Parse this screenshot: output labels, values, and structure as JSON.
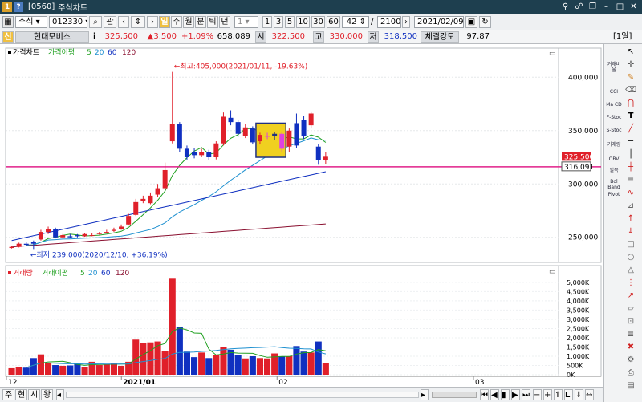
{
  "window": {
    "code": "[0560]",
    "title": "주식차트"
  },
  "toolbar": {
    "market": "주식",
    "symbol": "012330",
    "btn_relation": "관",
    "period_buttons": [
      "주",
      "월",
      "분",
      "틱",
      "년"
    ],
    "period_unit": "1",
    "minute_buttons": [
      "1",
      "3",
      "5",
      "10",
      "30",
      "60"
    ],
    "count": "42",
    "total": "2100",
    "date": "2021/02/09"
  },
  "quote": {
    "name": "현대모비스",
    "info_btn": "i",
    "price": "325,500",
    "change": "▲3,500",
    "pct": "+1.09%",
    "volume": "658,089",
    "open_label": "시",
    "open": "322,500",
    "high_label": "고",
    "high": "330,000",
    "low_label": "저",
    "low": "318,500",
    "strength_label": "체결강도",
    "strength": "97.87",
    "period_badge": "[1일]"
  },
  "price_panel": {
    "legend": {
      "name": "가격차트",
      "ma_label": "가격이평",
      "ma": [
        "5",
        "20",
        "60",
        "120"
      ]
    },
    "max_annot": "←최고:405,000(2021/01/11, -19.63%)",
    "min_annot": "←최저:239,000(2020/12/10, +36.19%)",
    "current_price_tag": "325,500",
    "line_price_tag": "316,091",
    "y_ticks": [
      "400,000",
      "350,000",
      "300,000",
      "250,000"
    ]
  },
  "volume_panel": {
    "legend": {
      "name": "거래량",
      "ma_label": "거래이평",
      "ma": [
        "5",
        "20",
        "60",
        "120"
      ]
    },
    "y_ticks": [
      "5,000K",
      "4,500K",
      "4,000K",
      "3,500K",
      "3,000K",
      "2,500K",
      "2,000K",
      "1,500K",
      "1,000K",
      "500K",
      "0K"
    ]
  },
  "x_axis": {
    "labels": [
      "12",
      "2021/01",
      "02",
      "03"
    ]
  },
  "bottom_tabs": [
    "주",
    "현",
    "시",
    "왕"
  ],
  "right_tools": [
    "거래비율",
    "CCI",
    "Ma CD",
    "F-Stoc",
    "S-Stoc",
    "거래량",
    "OBV",
    "일목",
    "Bol Band",
    "Pivot"
  ],
  "colors": {
    "up": "#e0202a",
    "down": "#1030c0",
    "ma5": "#20a020",
    "ma20": "#1e90d0",
    "ma60": "#1030c0",
    "ma120": "#8a1030",
    "hline": "#e0208a",
    "highlight": "#f0d020",
    "highlight_candle": "#e040e0"
  },
  "chart_data": {
    "type": "candlestick",
    "x": [
      "2020-12-07",
      "2020-12-08",
      "2020-12-09",
      "2020-12-10",
      "2020-12-11",
      "2020-12-14",
      "2020-12-15",
      "2020-12-16",
      "2020-12-17",
      "2020-12-18",
      "2020-12-21",
      "2020-12-22",
      "2020-12-23",
      "2020-12-24",
      "2020-12-28",
      "2020-12-29",
      "2020-12-30",
      "2021-01-04",
      "2021-01-05",
      "2021-01-06",
      "2021-01-07",
      "2021-01-08",
      "2021-01-11",
      "2021-01-12",
      "2021-01-13",
      "2021-01-14",
      "2021-01-15",
      "2021-01-18",
      "2021-01-19",
      "2021-01-20",
      "2021-01-21",
      "2021-01-22",
      "2021-01-25",
      "2021-01-26",
      "2021-01-27",
      "2021-01-28",
      "2021-01-29",
      "2021-02-01",
      "2021-02-02",
      "2021-02-03",
      "2021-02-04",
      "2021-02-05",
      "2021-02-08",
      "2021-02-09"
    ],
    "open": [
      240000,
      241000,
      244000,
      246000,
      248000,
      255000,
      258000,
      250000,
      251000,
      252000,
      251000,
      252000,
      253000,
      254000,
      256000,
      258000,
      262000,
      271000,
      284000,
      282000,
      290000,
      296000,
      340000,
      356000,
      333000,
      330000,
      327000,
      330000,
      325000,
      338000,
      362000,
      358000,
      345000,
      352000,
      340000,
      345000,
      345000,
      347000,
      335000,
      357000,
      360000,
      355000,
      335000,
      322500
    ],
    "close": [
      241000,
      244000,
      243000,
      244000,
      255000,
      258000,
      250000,
      252000,
      250000,
      251000,
      253000,
      252000,
      254000,
      255000,
      257000,
      260000,
      270000,
      283000,
      286000,
      289000,
      296000,
      313000,
      356000,
      333000,
      325000,
      327000,
      330000,
      325000,
      338000,
      363000,
      358000,
      347000,
      353000,
      339000,
      346000,
      345000,
      347000,
      333000,
      350000,
      336000,
      345000,
      366000,
      322000,
      325500
    ],
    "high": [
      242000,
      245000,
      246000,
      247000,
      257000,
      260000,
      259000,
      253000,
      253000,
      253000,
      254000,
      254000,
      255000,
      257000,
      259000,
      262000,
      272000,
      286000,
      289000,
      292000,
      300000,
      320000,
      405000,
      358000,
      336000,
      334000,
      333000,
      332000,
      340000,
      367000,
      369000,
      360000,
      356000,
      354000,
      348000,
      348000,
      349000,
      349000,
      352000,
      366000,
      364000,
      368000,
      337000,
      330000
    ],
    "low": [
      239500,
      240500,
      242000,
      239000,
      247000,
      253000,
      249000,
      249000,
      249500,
      250000,
      250500,
      251000,
      252500,
      253500,
      255000,
      257000,
      261000,
      270000,
      282000,
      281000,
      288000,
      294000,
      338000,
      330000,
      322000,
      324000,
      325000,
      322000,
      323000,
      336000,
      355000,
      344000,
      343000,
      337000,
      337000,
      342000,
      341000,
      330000,
      330000,
      334000,
      342000,
      352000,
      318000,
      318500
    ],
    "volume_k": [
      350,
      420,
      380,
      900,
      1100,
      650,
      520,
      480,
      500,
      600,
      430,
      700,
      520,
      560,
      620,
      480,
      700,
      1900,
      1700,
      1750,
      1800,
      1300,
      5200,
      2600,
      1250,
      950,
      1200,
      900,
      1050,
      1500,
      1350,
      1050,
      880,
      1000,
      900,
      880,
      1150,
      1000,
      1000,
      1550,
      1250,
      1200,
      1800,
      650
    ],
    "ylim": [
      228000,
      416000
    ],
    "volume_ylim_k": [
      0,
      5300
    ],
    "hline": 316091
  }
}
